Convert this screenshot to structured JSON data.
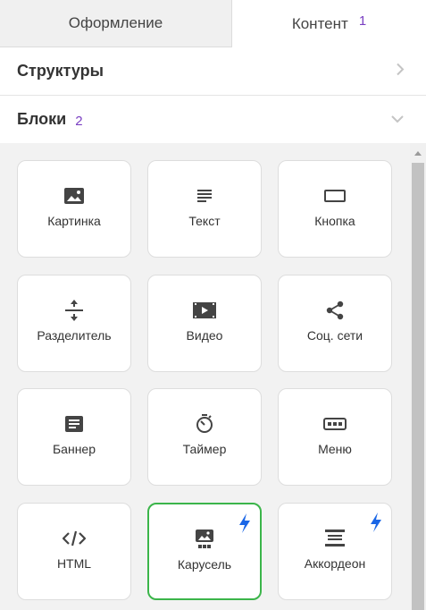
{
  "tabs": {
    "design": "Оформление",
    "content": "Контент",
    "content_marker": "1"
  },
  "sections": {
    "structures": {
      "title": "Структуры",
      "icon": "chevron-right-icon"
    },
    "blocks": {
      "title": "Блоки",
      "marker": "2",
      "icon": "chevron-down-icon"
    }
  },
  "blocks": [
    {
      "label": "Картинка",
      "icon": "image-icon"
    },
    {
      "label": "Текст",
      "icon": "text-lines-icon"
    },
    {
      "label": "Кнопка",
      "icon": "button-icon"
    },
    {
      "label": "Разделитель",
      "icon": "divider-icon"
    },
    {
      "label": "Видео",
      "icon": "video-icon"
    },
    {
      "label": "Соц. сети",
      "icon": "share-icon"
    },
    {
      "label": "Баннер",
      "icon": "banner-icon"
    },
    {
      "label": "Таймер",
      "icon": "timer-icon"
    },
    {
      "label": "Меню",
      "icon": "menu-icon"
    },
    {
      "label": "HTML",
      "icon": "code-icon"
    },
    {
      "label": "Карусель",
      "icon": "carousel-icon",
      "badge": "bolt-icon",
      "selected": true
    },
    {
      "label": "Аккордеон",
      "icon": "accordion-icon",
      "badge": "bolt-icon"
    }
  ],
  "colors": {
    "accent_bolt": "#1a66e6",
    "selected_border": "#3bb54a",
    "marker": "#7a3fc2"
  }
}
